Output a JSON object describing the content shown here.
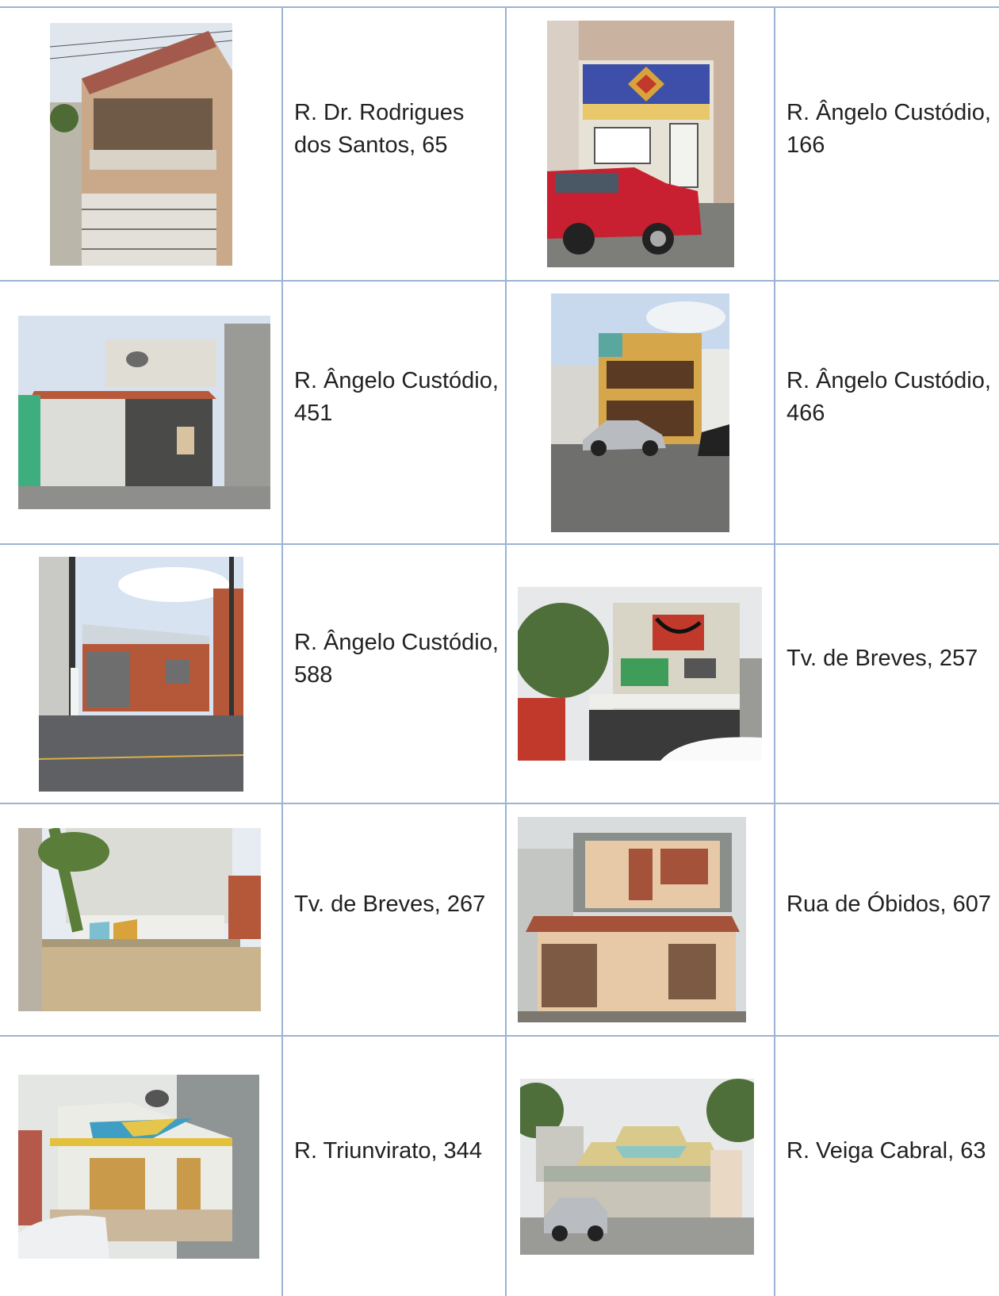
{
  "rows": [
    {
      "left": {
        "address": "R. Dr. Rodrigues dos Santos, 65",
        "photo": {
          "sky": "#dfe6ee",
          "wall": "#c9a989",
          "accent": "#a35a4c",
          "ground": "#8a8a86"
        }
      },
      "right": {
        "address": "R. Ângelo Custódio, 166",
        "photo": {
          "sky": "#c9b2a0",
          "wall": "#e7e2d6",
          "accent": "#3d4fa8",
          "ground": "#7d7d7a",
          "car": "#c82030"
        }
      }
    },
    {
      "left": {
        "address": "R. Ângelo Custódio, 451",
        "photo": {
          "sky": "#d8e2ee",
          "wall": "#dcdcd8",
          "accent": "#b85a3a",
          "ground": "#8e8f8c",
          "side": "#3fae7e"
        }
      },
      "right": {
        "address": "R. Ângelo Custódio, 466",
        "photo": {
          "sky": "#c8d9ee",
          "wall": "#d6a64a",
          "accent": "#5b3a24",
          "ground": "#6f6f6d",
          "car": "#b8bcc0"
        }
      }
    },
    {
      "left": {
        "address": "R. Ângelo Custódio, 588",
        "photo": {
          "sky": "#d7e3f0",
          "wall": "#b5583a",
          "accent": "#cfd6dc",
          "ground": "#5f6063"
        }
      },
      "right": {
        "address": "Tv. de Breves, 257",
        "photo": {
          "sky": "#e6e8ea",
          "wall": "#d8d5c6",
          "accent": "#c0392b",
          "ground": "#3a3a3a",
          "tree": "#4f6f3a"
        }
      }
    },
    {
      "left": {
        "address": "Tv. de Breves, 267",
        "photo": {
          "sky": "#e6ecf2",
          "wall": "#c9b48e",
          "accent": "#d9a33b",
          "ground": "#a7a49c",
          "tree": "#5a7d3a"
        }
      },
      "right": {
        "address": "Rua de Óbidos, 607",
        "photo": {
          "sky": "#d9dcdc",
          "wall": "#e7c9a8",
          "accent": "#a4523a",
          "ground": "#7c7870"
        }
      }
    },
    {
      "left": {
        "address": "R. Triunvirato, 344",
        "photo": {
          "sky": "#e4e6e4",
          "wall": "#ecece6",
          "accent": "#3f9ec4",
          "ground": "#8b6a5a",
          "car": "#eef0f2"
        }
      },
      "right": {
        "address": "R. Veiga Cabral, 63",
        "photo": {
          "sky": "#e7e9ea",
          "wall": "#d9c98a",
          "accent": "#8ec7c2",
          "ground": "#9a9a96",
          "car": "#b9bcc0"
        }
      }
    }
  ]
}
